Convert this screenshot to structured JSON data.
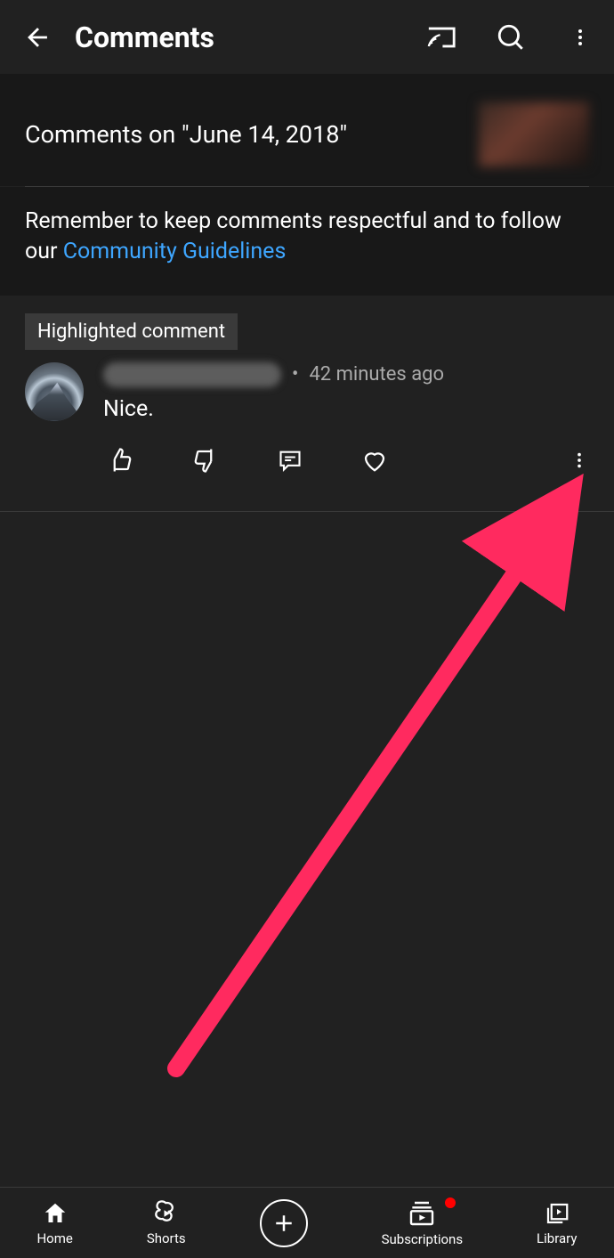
{
  "header": {
    "title": "Comments"
  },
  "video": {
    "comments_on_prefix": "Comments on \"",
    "video_title": "June 14, 2018",
    "comments_on_suffix": "\""
  },
  "guidelines": {
    "text": "Remember to keep comments respectful and to follow our ",
    "link_label": "Community Guidelines"
  },
  "highlight": {
    "label": "Highlighted comment"
  },
  "comment": {
    "timestamp": "42 minutes ago",
    "body": "Nice."
  },
  "nav": {
    "home": "Home",
    "shorts": "Shorts",
    "subscriptions": "Subscriptions",
    "library": "Library"
  }
}
